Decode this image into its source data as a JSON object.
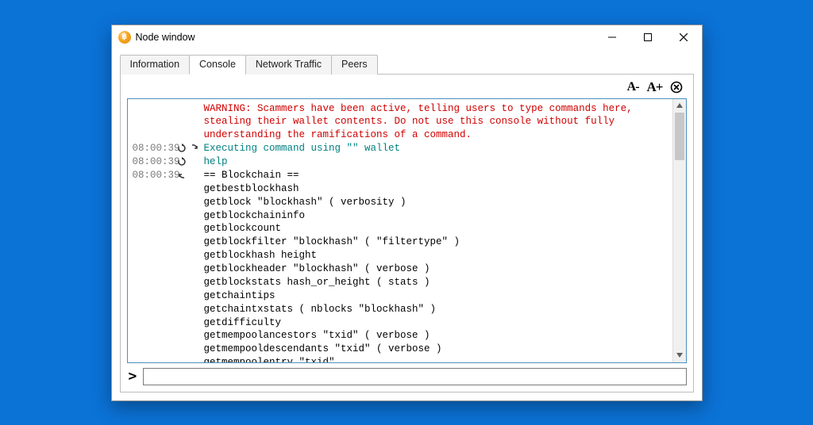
{
  "window": {
    "title": "Node window"
  },
  "tabs": [
    {
      "label": "Information"
    },
    {
      "label": "Console"
    },
    {
      "label": "Network Traffic"
    },
    {
      "label": "Peers"
    }
  ],
  "active_tab": 1,
  "toolbar": {
    "fontDecrease": "A-",
    "fontIncrease": "A+"
  },
  "console": {
    "warning": "WARNING: Scammers have been active, telling users to type commands here, stealing their wallet contents. Do not use this console without fully understanding the ramifications of a command.",
    "rows": [
      {
        "time": "08:00:39",
        "kind": "exec",
        "text": "Executing command using \"\" wallet"
      },
      {
        "time": "08:00:39",
        "kind": "cmd",
        "text": "help"
      },
      {
        "time": "08:00:39",
        "kind": "out",
        "text": "== Blockchain ==\ngetbestblockhash\ngetblock \"blockhash\" ( verbosity )\ngetblockchaininfo\ngetblockcount\ngetblockfilter \"blockhash\" ( \"filtertype\" )\ngetblockhash height\ngetblockheader \"blockhash\" ( verbose )\ngetblockstats hash_or_height ( stats )\ngetchaintips\ngetchaintxstats ( nblocks \"blockhash\" )\ngetdifficulty\ngetmempoolancestors \"txid\" ( verbose )\ngetmempooldescendants \"txid\" ( verbose )\ngetmempoolentry \"txid\"\ngetmempoolinfo"
      }
    ]
  },
  "prompt": {
    "arrow": ">",
    "value": ""
  }
}
